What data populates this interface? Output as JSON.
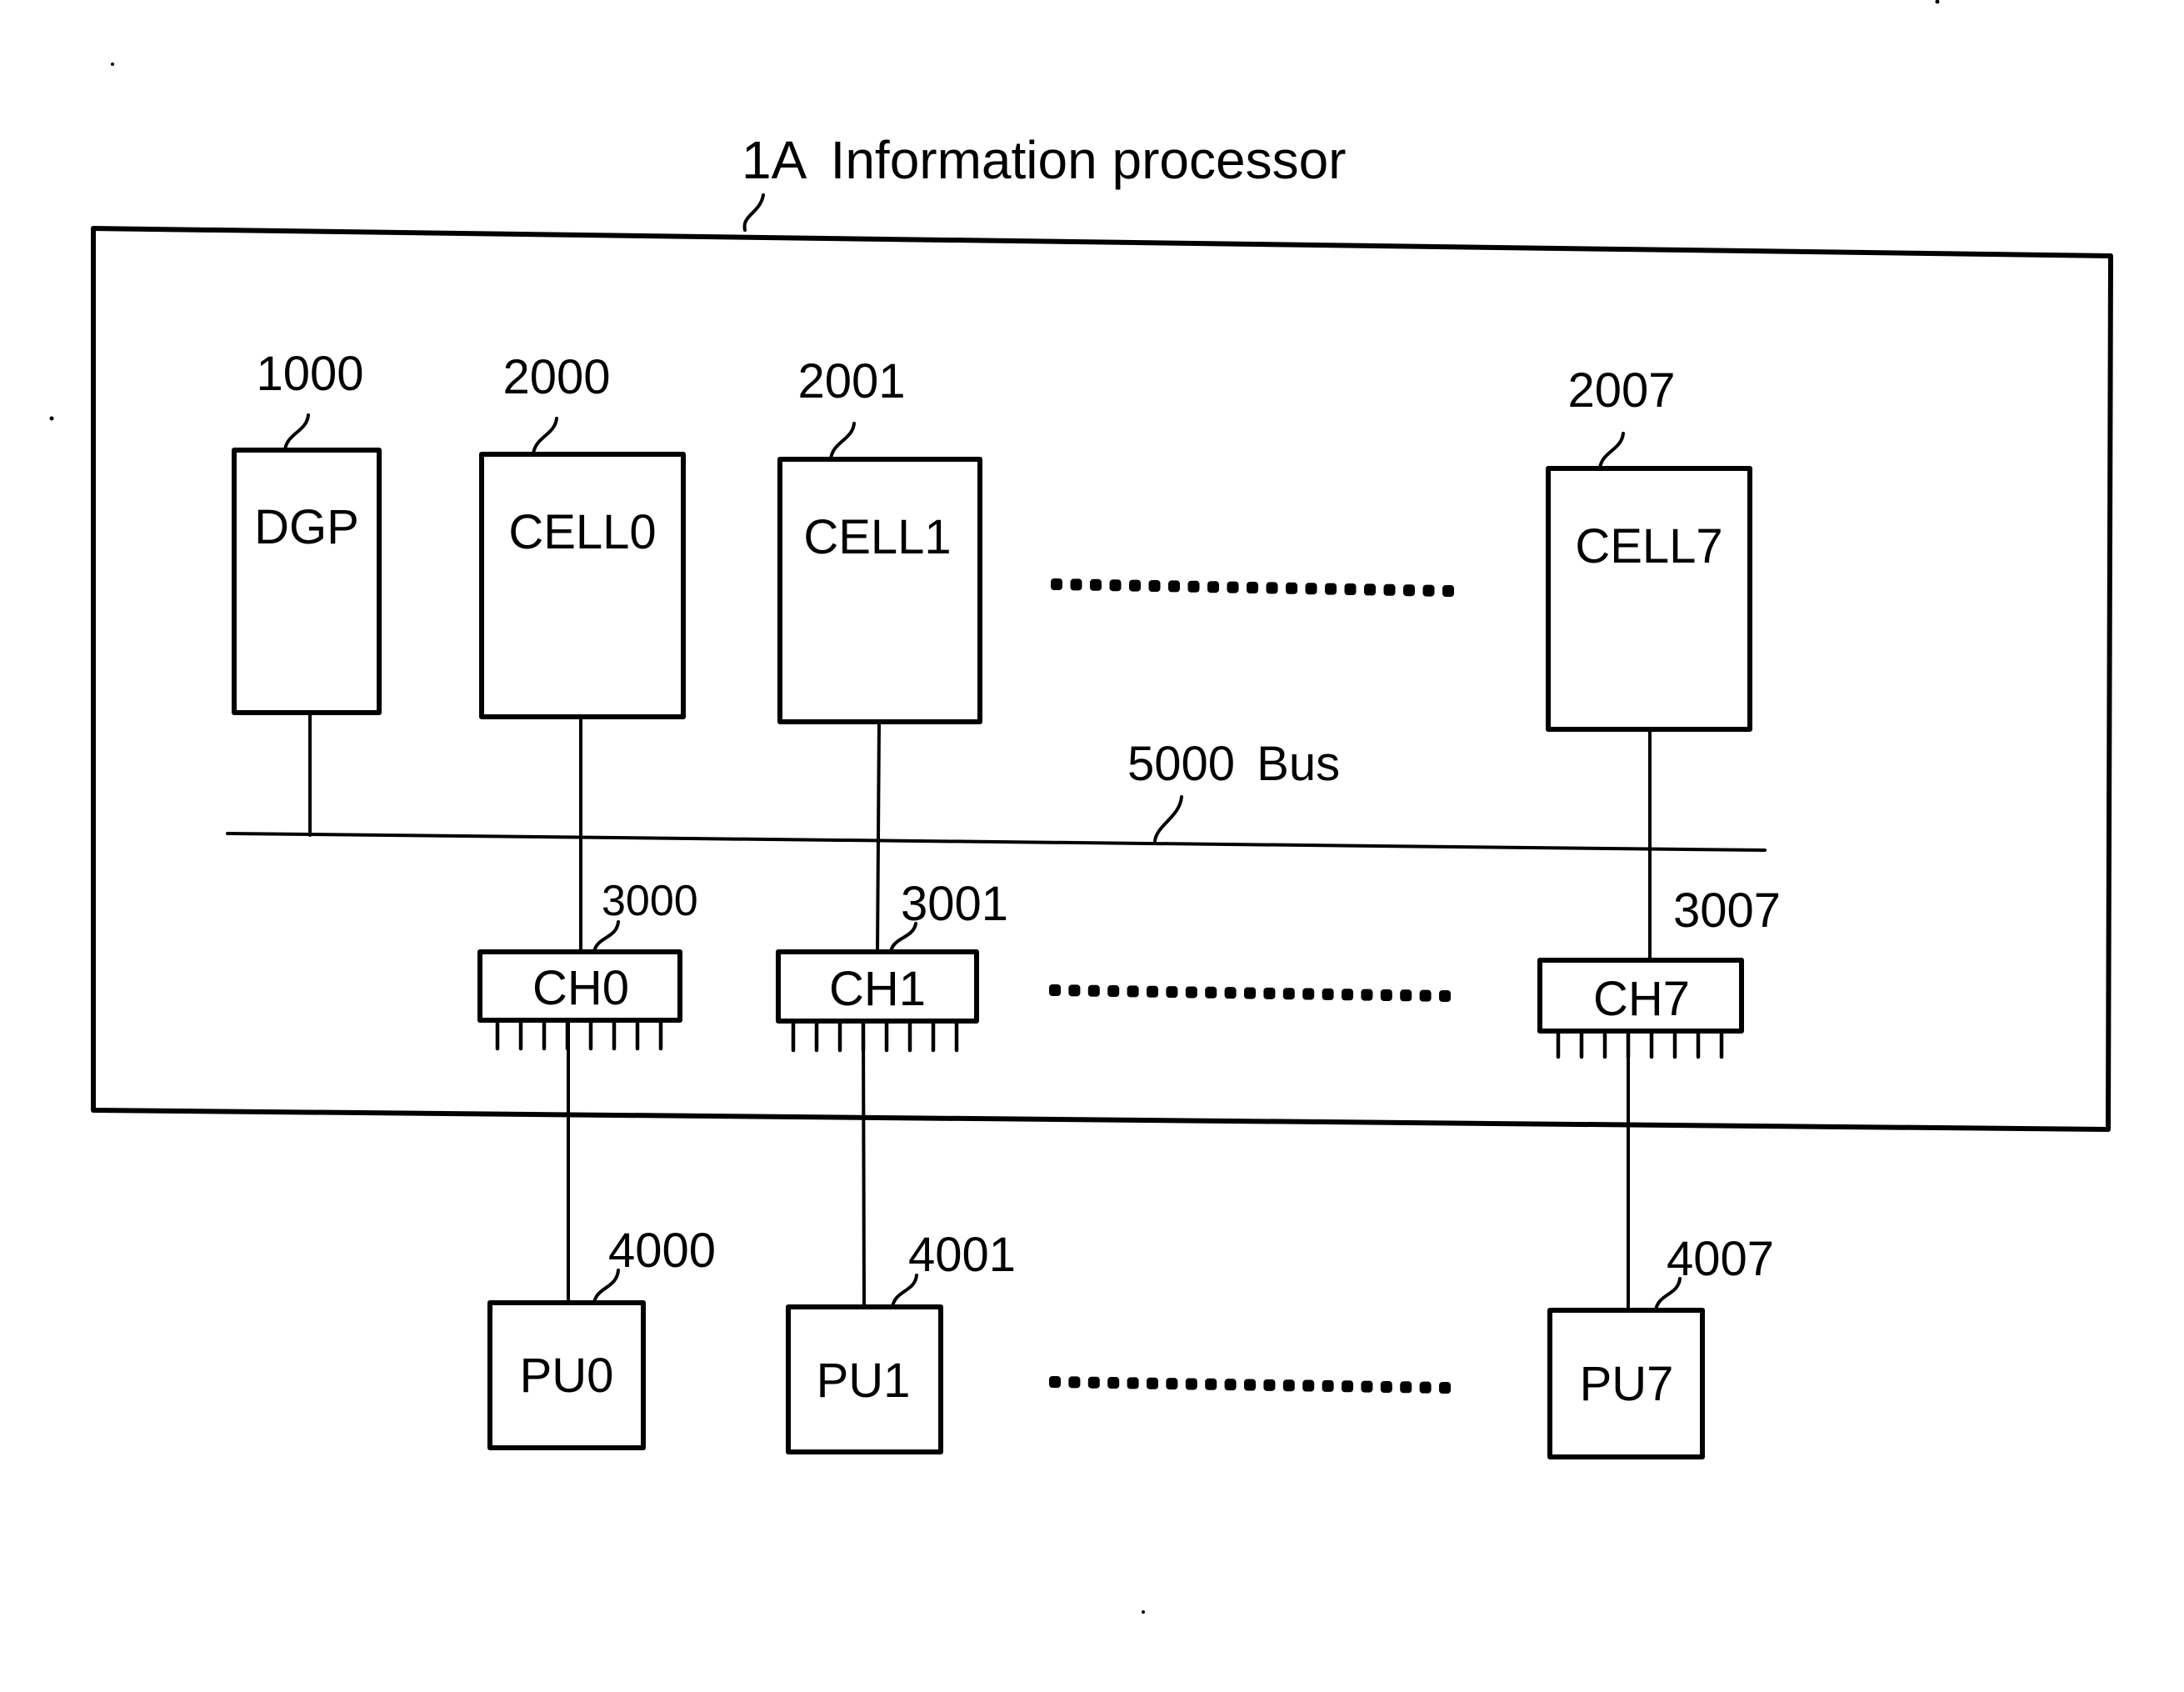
{
  "title": {
    "ref": "1A",
    "text": "Information processor"
  },
  "bus": {
    "ref": "5000",
    "label": "Bus"
  },
  "top_units": [
    {
      "ref": "1000",
      "label": "DGP"
    },
    {
      "ref": "2000",
      "label": "CELL0"
    },
    {
      "ref": "2001",
      "label": "CELL1"
    },
    {
      "ref": "2007",
      "label": "CELL7"
    }
  ],
  "channels": [
    {
      "ref": "3000",
      "label": "CH0"
    },
    {
      "ref": "3001",
      "label": "CH1"
    },
    {
      "ref": "3007",
      "label": "CH7"
    }
  ],
  "processing_units": [
    {
      "ref": "4000",
      "label": "PU0"
    },
    {
      "ref": "4001",
      "label": "PU1"
    },
    {
      "ref": "4007",
      "label": "PU7"
    }
  ],
  "ellipsis_rows": [
    "cells",
    "channels",
    "processing_units"
  ],
  "colors": {
    "line": "#000000",
    "background": "#ffffff"
  }
}
